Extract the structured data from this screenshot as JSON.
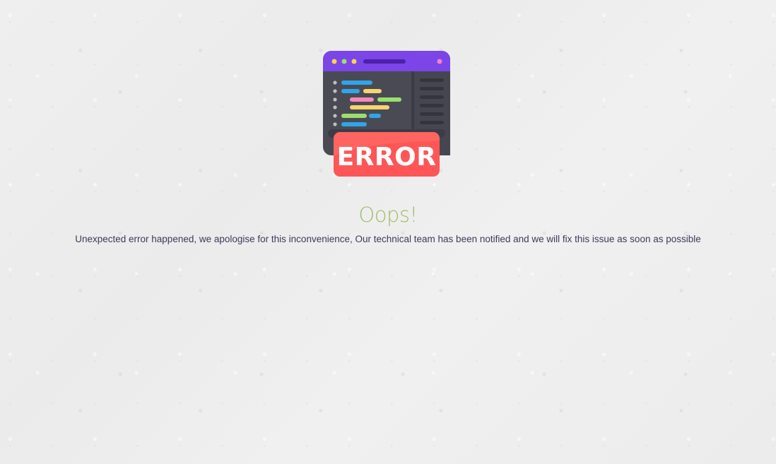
{
  "illustration": {
    "icon": "browser-error-icon",
    "badge_text": "ERROR",
    "colors": {
      "titlebar": "#7b45e8",
      "window_body": "#4a4a56",
      "badge": "#fe5557"
    }
  },
  "error_page": {
    "title": "Oops!",
    "message": "Unexpected error happened, we apologise for this inconvenience, Our technical team has been notified and we will fix this issue as soon as possible"
  },
  "colors": {
    "background": "#eeeeee",
    "title": "#9cbf6a",
    "message": "#3c3a5c"
  }
}
